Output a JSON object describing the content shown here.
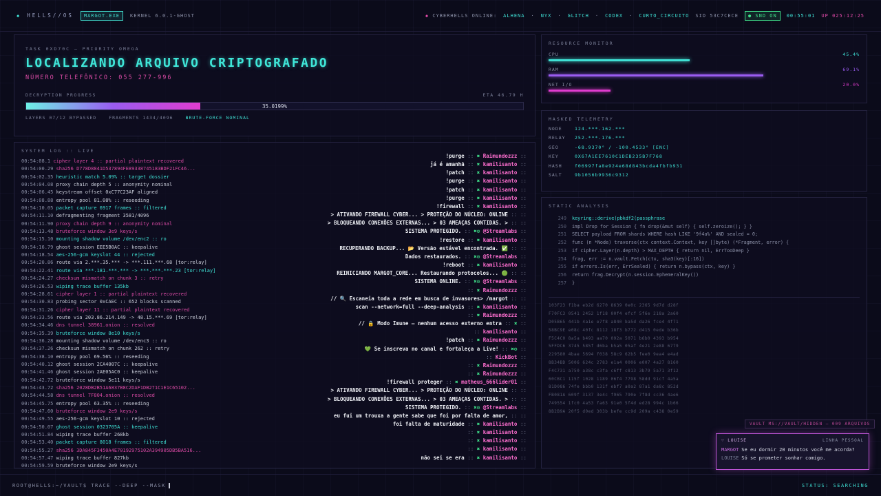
{
  "topbar": {
    "logo": "◆",
    "brand": "HELLS//OS",
    "chip": "MARGOT.EXE",
    "kernel": "KERNEL 6.0.1-GHOST",
    "online_label": "CYBERHELLS ONLINE:",
    "users": [
      "ALHENA",
      "NYX",
      "GLITCH",
      "CODEX",
      "CURTO_CIRCUITO"
    ],
    "sid": "SID 53C7CECE",
    "snd": "SND ON",
    "clock": "00:55:01",
    "uptime": "UP 025:12:25"
  },
  "task": {
    "label": "TASK 0XD70C — PRIORITY OMEGA",
    "title": "LOCALIZANDO ARQUIVO CRIPTOGRAFADO",
    "phone": "NÚMERO TELEFÔNICO: 055 277-996",
    "progress_label": "DECRYPTION PROGRESS",
    "eta": "ETA 46.79 H",
    "progress_text": "35.0199%",
    "progress": 0.35,
    "layers": "LAYERS 07/12 BYPASSED",
    "fragments": "FRAGMENTS 1434/4096",
    "status": "BRUTE-FORCE NOMINAL"
  },
  "log": {
    "title": "SYSTEM LOG :: LIVE",
    "lines": [
      {
        "t": "00:54:08.1",
        "m": "cipher layer 4 :: partial plaintext recovered",
        "c": "lm"
      },
      {
        "t": "00:54:00.29",
        "m": "sha256 D778D8841D537894FE89338745183BDF21FC46...",
        "c": "lm"
      },
      {
        "t": "00:54:02.35",
        "m": "heuristic match 5.09% :: target dossier",
        "c": "lc"
      },
      {
        "t": "00:54:04.08",
        "m": "proxy chain depth 5 :: anonymity nominal",
        "c": "lw"
      },
      {
        "t": "00:54:06.45",
        "m": "keystream offset 0xC77C23AF aligned",
        "c": "lw"
      },
      {
        "t": "00:54:08.88",
        "m": "entropy pool 81.08% :: reseeding",
        "c": "lw"
      },
      {
        "t": "00:54:10.05",
        "m": "packet capture 6917 frames :: filtered",
        "c": "lc"
      },
      {
        "t": "00:54:11.10",
        "m": "defragmenting fragment 3581/4096",
        "c": "lw"
      },
      {
        "t": "00:54:11.90",
        "m": "proxy chain depth 9 :: anonymity nominal",
        "c": "lm"
      },
      {
        "t": "00:54:13.48",
        "m": "bruteforce window 3e9 keys/s",
        "c": "lm"
      },
      {
        "t": "00:54:15.10",
        "m": "mounting shadow volume /dev/enc2 :: ro",
        "c": "lc"
      },
      {
        "t": "00:54:16.79",
        "m": "ghost session EEE5B0AC :: keepalive",
        "c": "lw"
      },
      {
        "t": "00:54:18.54",
        "m": "aes-256-gcm keyslot 44 :: rejected",
        "c": "lc"
      },
      {
        "t": "00:54:20.86",
        "m": "route via 2.***.35.*** -> ***.111.***.68 [tor:relay]",
        "c": "lw"
      },
      {
        "t": "00:54:22.41",
        "m": "route via ***.181.***.*** -> ***.***.***.23 [tor:relay]",
        "c": "lc"
      },
      {
        "t": "00:54:24.27",
        "m": "checksum mismatch on chunk 3 :: retry",
        "c": "lm"
      },
      {
        "t": "00:54:26.53",
        "m": "wiping trace buffer 135kb",
        "c": "lc"
      },
      {
        "t": "00:54:28.61",
        "m": "cipher layer 1 :: partial plaintext recovered",
        "c": "lm"
      },
      {
        "t": "00:54:30.83",
        "m": "probing sector 0xCAEC :: 652 blocks scanned",
        "c": "lw"
      },
      {
        "t": "00:54:31.26",
        "m": "cipher layer 11 :: partial plaintext recovered",
        "c": "lm"
      },
      {
        "t": "00:54:33.56",
        "m": "route via 203.86.214.149 -> 48.15.***.69 [tor:relay]",
        "c": "lw"
      },
      {
        "t": "00:54:34.46",
        "m": "dns tunnel 38961.onion :: resolved",
        "c": "lm"
      },
      {
        "t": "00:54:35.39",
        "m": "bruteforce window 8e10 keys/s",
        "c": "lc"
      },
      {
        "t": "00:54:36.28",
        "m": "mounting shadow volume /dev/enc3 :: ro",
        "c": "lw"
      },
      {
        "t": "00:54:37.26",
        "m": "checksum mismatch on chunk 262 :: retry",
        "c": "lw"
      },
      {
        "t": "00:54:38.10",
        "m": "entropy pool 69.56% :: reseeding",
        "c": "lw"
      },
      {
        "t": "00:54:40.12",
        "m": "ghost session 2CA4007C :: keepalive",
        "c": "lw"
      },
      {
        "t": "00:54:41.46",
        "m": "ghost session 2AE05AC0 :: keepalive",
        "c": "lw"
      },
      {
        "t": "00:54:42.72",
        "m": "bruteforce window 5e11 keys/s",
        "c": "lw"
      },
      {
        "t": "00:54:43.72",
        "m": "sha256 2028DB2B51A6837B8C2DAF1DB271C1E1C65102...",
        "c": "lm"
      },
      {
        "t": "00:54:44.58",
        "m": "dns tunnel 7F804.onion :: resolved",
        "c": "lm"
      },
      {
        "t": "00:54:45.75",
        "m": "entropy pool 63.35% :: reseeding",
        "c": "lw"
      },
      {
        "t": "00:54:47.60",
        "m": "bruteforce window 2e9 keys/s",
        "c": "lm"
      },
      {
        "t": "00:54:49.55",
        "m": "aes-256-gcm keyslot 10 :: rejected",
        "c": "lw"
      },
      {
        "t": "00:54:50.07",
        "m": "ghost session 0323705A :: keepalive",
        "c": "lc"
      },
      {
        "t": "00:54:51.84",
        "m": "wiping trace buffer 268kb",
        "c": "lw"
      },
      {
        "t": "00:54:53.40",
        "m": "packet capture 8018 frames :: filtered",
        "c": "lc"
      },
      {
        "t": "00:54:55.27",
        "m": "sha256 3DA845F3450A4E70192975102A394905DB5BA516...",
        "c": "lm"
      },
      {
        "t": "00:54:57.47",
        "m": "wiping trace buffer 827kb",
        "c": "lw"
      },
      {
        "t": "00:54:59.59",
        "m": "bruteforce window 2e9 keys/s",
        "c": "lw"
      },
      {
        "t": "00:55:01.09",
        "m": "checksum mismatch on chunk 1138 :: retry",
        "c": "lw"
      }
    ]
  },
  "chat": [
    {
      "m": "!purge",
      "i": "✖",
      "u": "Raimundozzz"
    },
    {
      "m": "já é amanhã",
      "i": "✖",
      "u": "kamilisanto"
    },
    {
      "m": "!patch",
      "i": "✖",
      "u": "kamilisanto"
    },
    {
      "m": "!purge",
      "i": "✖",
      "u": "kamilisanto"
    },
    {
      "m": "!patch",
      "i": "✖",
      "u": "kamilisanto"
    },
    {
      "m": "!purge",
      "i": "✖",
      "u": "kamilisanto"
    },
    {
      "m": "!firewall",
      "i": "✖",
      "u": "kamilisanto"
    },
    {
      "m": "> ATIVANDO FIREWALL CYBER... > PROTEÇÃO DO NÚCLEO: ONLINE",
      "i": "",
      "u": ""
    },
    {
      "m": "> BLOQUEANDO CONEXÕES EXTERNAS... > 03 AMEAÇAS CONTIDAS. >",
      "i": "",
      "u": ""
    },
    {
      "m": "SISTEMA PROTEGIDO.",
      "i": "✖⚙",
      "u": "@Streamlabs"
    },
    {
      "m": "!restore",
      "i": "✖",
      "u": "kamilisanto"
    },
    {
      "m": "RECUPERANDO BACKUP... 📂 Versão estável encontrada. ✅",
      "i": "",
      "u": ""
    },
    {
      "m": "Dados restaurados.",
      "i": "✖⚙",
      "u": "@Streamlabs"
    },
    {
      "m": "!reboot",
      "i": "✖",
      "u": "kamilisanto"
    },
    {
      "m": "REINICIANDO MARGOT_CORE... Restaurando protocolos... 🟢",
      "i": "",
      "u": ""
    },
    {
      "m": "SISTEMA ONLINE.",
      "i": "✖⚙",
      "u": "@Streamlabs"
    },
    {
      "m": "",
      "i": "✖",
      "u": "Raimundozzz"
    },
    {
      "m": "// 🔍 Escaneia toda a rede em busca de invasores> /margot",
      "i": "",
      "u": ""
    },
    {
      "m": "scan --network=full --deep-analysis",
      "i": "✖",
      "u": "kamilisanto"
    },
    {
      "m": "",
      "i": "✖",
      "u": "Raimundozzz"
    },
    {
      "m": "// 🔒 Modo Imune — nenhum acesso externo entra",
      "i": "✖",
      "u": ""
    },
    {
      "m": "",
      "i": "",
      "u": "kamilisanto"
    },
    {
      "m": "!patch",
      "i": "✖",
      "u": "Raimundozzz"
    },
    {
      "m": "💚 Se inscreva no canal e fortaleça a Live!",
      "i": "✖⚙",
      "u": ""
    },
    {
      "m": "",
      "i": "",
      "u": "KickBot"
    },
    {
      "m": "",
      "i": "✖",
      "u": "Raimundozzz"
    },
    {
      "m": "",
      "i": "✖",
      "u": "Raimundozzz"
    },
    {
      "m": "!firewall proteger",
      "i": "✖",
      "u": "matheus_666lider01"
    },
    {
      "m": "> ATIVANDO FIREWALL CYBER... > PROTEÇÃO DO NÚCLEO: ONLINE",
      "i": "",
      "u": ""
    },
    {
      "m": "> BLOQUEANDO CONEXÕES EXTERNAS... > 03 AMEAÇAS CONTIDAS. >",
      "i": "",
      "u": ""
    },
    {
      "m": "SISTEMA PROTEGIDO.",
      "i": "✖⚙",
      "u": "@Streamlabs"
    },
    {
      "m": "eu fui um trouxa a gente sabe que foi por falta de amor,",
      "i": "",
      "u": ""
    },
    {
      "m": "foi falta de maturidade",
      "i": "✖",
      "u": "kamilisanto"
    },
    {
      "m": "",
      "i": "✖",
      "u": "kamilisanto"
    },
    {
      "m": "",
      "i": "✖",
      "u": "kamilisanto"
    },
    {
      "m": "",
      "i": "✖",
      "u": "kamilisanto"
    },
    {
      "m": "não sei se era",
      "i": "✖",
      "u": "kamilisanto"
    }
  ],
  "resources": {
    "title": "RESOURCE MONITOR",
    "items": [
      {
        "label": "CPU",
        "value": "45.4%",
        "frac": 0.454,
        "color": "#3fe0d4"
      },
      {
        "label": "RAM",
        "value": "69.1%",
        "frac": 0.691,
        "color": "#9a5cf0"
      },
      {
        "label": "NET I/O",
        "value": "20.0%",
        "frac": 0.2,
        "color": "#e03ccf"
      }
    ]
  },
  "telemetry": {
    "title": "MASKED TELEMETRY",
    "rows": [
      {
        "k": "NODE",
        "v": "124.***.162.***"
      },
      {
        "k": "RELAY",
        "v": "252.***.176.***"
      },
      {
        "k": "GEO",
        "v": "-68.9370° / -100.4533° [ENC]"
      },
      {
        "k": "KEY",
        "v": "0X67A1EE7610C1DEB235B7F768"
      },
      {
        "k": "HASH",
        "v": "f06997fa8e924e68d843bcda4fbfb931"
      },
      {
        "k": "SALT",
        "v": "9b1056b9936c9312"
      }
    ]
  },
  "static": {
    "title": "STATIC ANALYSIS",
    "lines": [
      {
        "n": "249",
        "c": "keyring::derive(pbkdf2(passphrase"
      },
      {
        "n": "250",
        "c": "impl Drop for Session { fn drop(&mut self) { self.zeroize(); } }"
      },
      {
        "n": "251",
        "c": "SELECT payload FROM shards WHERE hash LIKE '9f4a%' AND sealed = 0;"
      },
      {
        "n": "252",
        "c": "func (n *Node) traverse(ctx context.Context, key []byte) (*Fragment, error) {"
      },
      {
        "n": "253",
        "c": "if cipher.Layer(n.depth) > MAX_DEPTH { return nil, ErrTooDeep }"
      },
      {
        "n": "254",
        "c": "frag, err := n.vault.Fetch(ctx, sha3(key)[:16])"
      },
      {
        "n": "255",
        "c": "if errors.Is(err, ErrSealed) { return n.bypass(ctx, key) }"
      },
      {
        "n": "256",
        "c": "return frag.Decrypt(n.session.EphemeralKey())"
      },
      {
        "n": "257",
        "c": "}"
      }
    ],
    "hex": [
      "103F23 f1ba eb2d 6270 8639 0e0c 2365 9d7d d28f",
      "F70FC3 0541 2452 1f18 00f4 efcf 5f6e 218a 2a60",
      "D05B65 441b 4a1e e7f8 a840 ba5d da26 fce4 4f71",
      "58BC9E e08c 40fc 8112 18f3 b772 d415 0ede b36b",
      "F5C4C0 8a5a b493 aa70 092a 5071 b6b0 4393 b954",
      "5FFDC6 3745 585f d6ba b5a5 05af 4e21 2e88 6779",
      "229580 4bae 5694 f038 58c9 62b5 fee0 9ea4 e4ad",
      "8B34BD 5006 624c 2783 e1a4 0006 e007 4a27 8160",
      "F4C731 a750 a38c c3fa c6ff c813 3b79 5a71 3f12",
      "60CBC1 115f 1028 1189 06f4 7798 58dd 91cf 4a5a",
      "81D086 74fe bbb0 131f ebf7 a0a2 87a1 da8c 852d",
      "FB081A 609f 3137 3e4c f965 790e 7f8d cc36 4ae6",
      "749554 1fc0 4a53 fa63 91e0 5f4d ed28 994c 1b66",
      "8B2B9A 20f5 d0ed 303b befe cc9d 209a c438 0e59"
    ]
  },
  "vault_text": "VAULT MS://VAULT/HIDDEN — 009 ARQUIVOS",
  "notification": {
    "name": "LOUISE",
    "tag": "LINHA PESSOAL",
    "k1": "MARGOT",
    "m1": "Se eu dormir 20 minutos você me acorda?",
    "k2": "LOUISE",
    "m2": "Só se prometer sonhar comigo."
  },
  "bottom": {
    "prompt": "ROOT@HELLS:~/VAULT$ TRACE --DEEP --MASK",
    "status": "STATUS: SEARCHING"
  }
}
